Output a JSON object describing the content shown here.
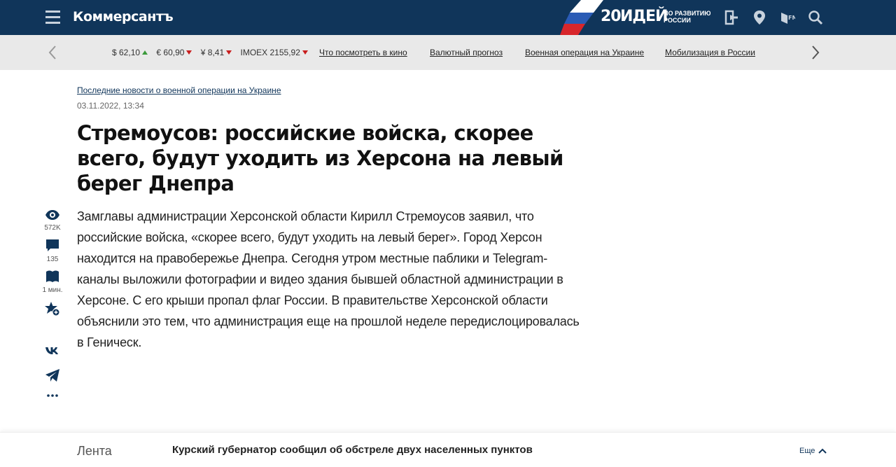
{
  "header": {
    "logo": "Коммерсантъ",
    "promo_number": "20",
    "promo_word": "ИДЕЙ",
    "promo_sub": "ПО РАЗВИТИЮ РОССИИ",
    "icons": [
      "login-icon",
      "location-icon",
      "radio-fm-icon",
      "search-icon"
    ],
    "colors": {
      "bar": "#10355a",
      "ticker_bg": "#e9e9e9",
      "up": "#3a9a3a",
      "down": "#c81e1e"
    }
  },
  "ticker": {
    "rates": [
      {
        "label": "$ 62,10",
        "trend": "up"
      },
      {
        "label": "€ 60,90",
        "trend": "down"
      },
      {
        "label": "¥ 8,41",
        "trend": "down"
      },
      {
        "label": "IMOEX 2155,92",
        "trend": "down"
      }
    ],
    "links": [
      "Что посмотреть в кино",
      "Валютный прогноз",
      "Военная операция на Украине",
      "Мобилизация в России"
    ]
  },
  "article": {
    "rubric": "Последние новости о военной операции на Украине",
    "date": "03.11.2022, 13:34",
    "title": "Стремоусов: российские войска, скорее всего, будут уходить из Херсона на левый берег Днепра",
    "lead": "Замглавы администрации Херсонской области Кирилл Стремоусов заявил, что российские войска, «скорее всего, будут уходить на левый берег». Город Херсон находится на правобережье Днепра. Сегодня утром местные паблики и Telegram-каналы выложили фотографии и видео здания бывшей областной администрации в Херсоне. С его крыши пропал флаг России. В правительстве Херсонской области объяснили это тем, что администрация еще на прошлой неделе передислоцировалась в Геническ."
  },
  "rail": {
    "views": "572K",
    "comments": "135",
    "reading_time": "1 мин."
  },
  "feed": {
    "title": "Лента",
    "headline": "Курский губернатор сообщил об обстреле двух населенных пунктов",
    "more": "Еще"
  }
}
